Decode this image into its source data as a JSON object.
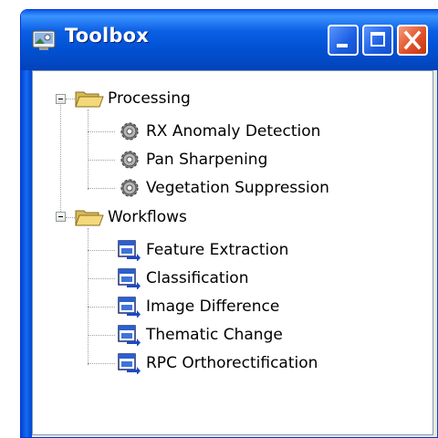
{
  "window": {
    "title": "Toolbox"
  },
  "tree": {
    "groups": [
      {
        "label": "Processing",
        "expanded": true,
        "items": [
          {
            "label": "RX Anomaly Detection",
            "icon": "gear-icon"
          },
          {
            "label": "Pan Sharpening",
            "icon": "gear-icon"
          },
          {
            "label": "Vegetation Suppression",
            "icon": "gear-icon"
          }
        ]
      },
      {
        "label": "Workflows",
        "expanded": true,
        "items": [
          {
            "label": "Feature Extraction",
            "icon": "workflow-icon"
          },
          {
            "label": "Classification",
            "icon": "workflow-icon"
          },
          {
            "label": "Image Difference",
            "icon": "workflow-icon"
          },
          {
            "label": "Thematic Change",
            "icon": "workflow-icon"
          },
          {
            "label": "RPC Orthorectification",
            "icon": "workflow-icon"
          }
        ]
      }
    ]
  },
  "colors": {
    "titlebar_blue": "#0253d6",
    "close_red": "#e1522c",
    "folder_yellow": "#f3d97a"
  }
}
